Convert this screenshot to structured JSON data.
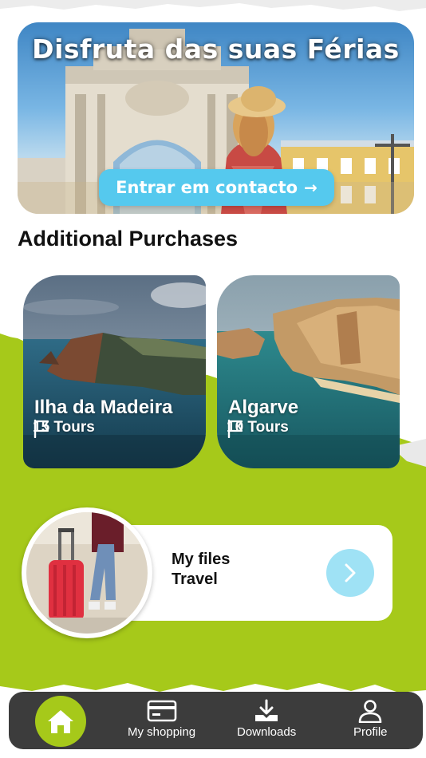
{
  "hero": {
    "title": "Disfruta das suas Férias",
    "cta_label": "Entrar em contacto",
    "cta_icon": "arrow-right-icon"
  },
  "section": {
    "title": "Additional Purchases"
  },
  "destinations": [
    {
      "name": "Ilha da Madeira",
      "tours": "15 Tours",
      "icon": "flag-icon"
    },
    {
      "name": "Algarve",
      "tours": "10 Tours",
      "icon": "flag-icon"
    }
  ],
  "files": {
    "line1": "My files",
    "line2": "Travel",
    "icon": "chevron-right-icon"
  },
  "nav": {
    "home_icon": "home-icon",
    "items": [
      {
        "label": "My shopping",
        "icon": "card-icon"
      },
      {
        "label": "Downloads",
        "icon": "download-icon"
      },
      {
        "label": "Profile",
        "icon": "user-icon"
      }
    ]
  },
  "colors": {
    "accent_green": "#a6c91a",
    "cta_blue": "#55c9ee",
    "nav_dark": "#3c3c3c",
    "chevron_bg": "#9fe2f5"
  }
}
